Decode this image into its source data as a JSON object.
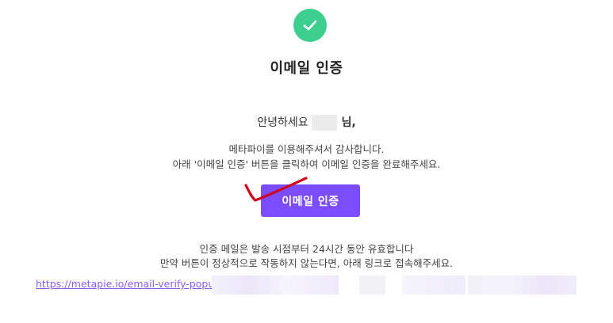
{
  "icons": {
    "success": "check-icon"
  },
  "colors": {
    "success_green": "#3ccf8e",
    "brand_purple": "#7c4dff",
    "link_purple": "#8a5cf6",
    "annotation_red": "#d0021b"
  },
  "email": {
    "title": "이메일 인증",
    "greeting_prefix": "안녕하세요",
    "greeting_suffix": "님,",
    "intro_line1": "메타파이를 이용해주셔서 감사합니다.",
    "intro_line2": "아래 '이메일 인증' 버튼을 클릭하여 이메일 인증을 완료해주세요.",
    "verify_button_label": "이메일 인증",
    "validity_line": "인증 메일은 발송 시점부터 24시간 동안 유효합니다",
    "fallback_line": "만약 버튼이 정상적으로 작동하지 않는다면, 아래 링크로 접속해주세요.",
    "verify_link": "https://metapie.io/email-verify-popup?"
  }
}
